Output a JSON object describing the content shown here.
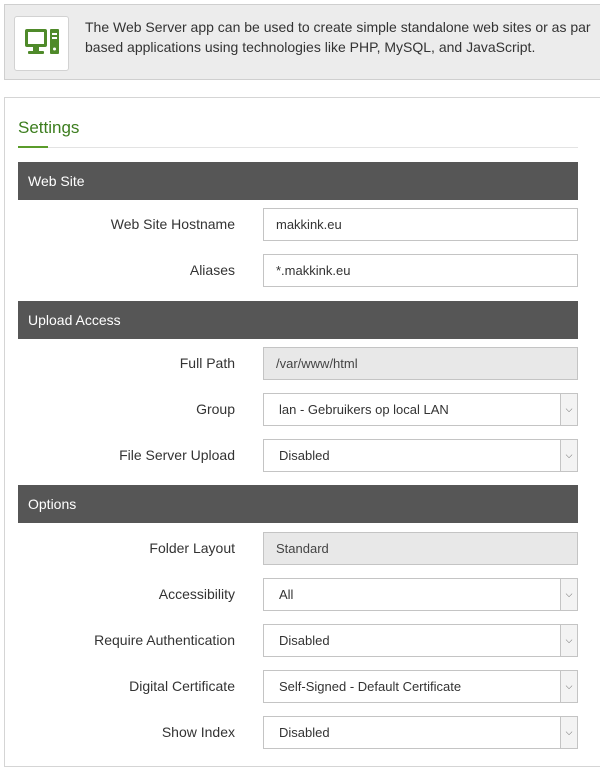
{
  "banner": {
    "icon": "web-server-computer-icon",
    "text": "The Web Server app can be used to create simple standalone web sites or as par\nbased applications using technologies like PHP, MySQL, and JavaScript."
  },
  "settings": {
    "title": "Settings"
  },
  "sections": {
    "web_site": {
      "title": "Web Site",
      "hostname_label": "Web Site Hostname",
      "hostname_value": "makkink.eu",
      "aliases_label": "Aliases",
      "aliases_value": "*.makkink.eu"
    },
    "upload_access": {
      "title": "Upload Access",
      "full_path_label": "Full Path",
      "full_path_value": "/var/www/html",
      "group_label": "Group",
      "group_value": "lan - Gebruikers op local LAN",
      "file_server_upload_label": "File Server Upload",
      "file_server_upload_value": "Disabled"
    },
    "options": {
      "title": "Options",
      "folder_layout_label": "Folder Layout",
      "folder_layout_value": "Standard",
      "accessibility_label": "Accessibility",
      "accessibility_value": "All",
      "require_auth_label": "Require Authentication",
      "require_auth_value": "Disabled",
      "digital_cert_label": "Digital Certificate",
      "digital_cert_value": "Self-Signed - Default Certificate",
      "show_index_label": "Show Index",
      "show_index_value": "Disabled"
    }
  },
  "colors": {
    "accent": "#3c7d1e",
    "section_bar": "#565656",
    "icon_green": "#4f8a2a"
  }
}
